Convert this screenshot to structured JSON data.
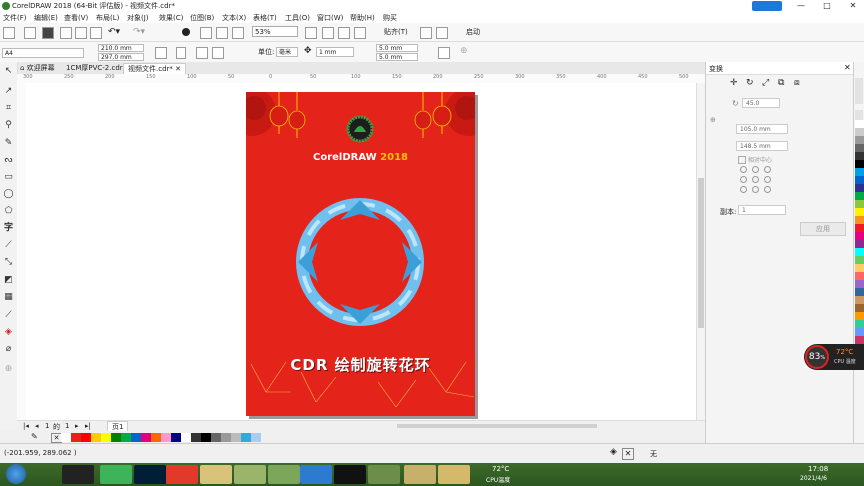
{
  "window": {
    "title": "CorelDRAW 2018 (64-Bit 评估版) - 视频文件.cdr*",
    "buttons": [
      "—",
      "□",
      "✕"
    ]
  },
  "menu": [
    "文件(F)",
    "编辑(E)",
    "查看(V)",
    "布局(L)",
    "对象(J)",
    "效果(C)",
    "位图(B)",
    "文本(X)",
    "表格(T)",
    "工具(O)",
    "窗口(W)",
    "帮助(H)",
    "购买"
  ],
  "toolbar": {
    "zoom": "53%",
    "snap_label": "贴齐(T)",
    "launch_label": "启动"
  },
  "property_bar": {
    "page_size": "A4",
    "width": "210.0 mm",
    "height": "297.0 mm",
    "units_label": "单位:",
    "units_value": "毫米",
    "nudge": "1 mm",
    "dup_x": "5.0 mm",
    "dup_y": "5.0 mm"
  },
  "tabs": [
    {
      "label": "欢迎屏幕",
      "active": false
    },
    {
      "label": "1CM厚PVC-2.cdr",
      "active": false
    },
    {
      "label": "视频文件.cdr*",
      "active": true
    }
  ],
  "ruler": {
    "h_ticks": [
      "300",
      "250",
      "200",
      "150",
      "100",
      "50",
      "0",
      "50",
      "100",
      "150",
      "200",
      "250",
      "300",
      "350",
      "400",
      "450",
      "500"
    ],
    "unit": "毫米"
  },
  "design": {
    "brand_main": "CorelDRAW",
    "brand_year": "2018",
    "title": "CDR 绘制旋转花环",
    "background_color": "#e4231b",
    "ribbon_color": "#6fc0ee"
  },
  "page_nav": {
    "current": "1",
    "of_label": "的",
    "total": "1",
    "page_tab": "页1"
  },
  "palette": [
    "#ffffff",
    "#e4231b",
    "#ff0000",
    "#ffcc00",
    "#ffff00",
    "#008000",
    "#00aa44",
    "#0066cc",
    "#e6007e",
    "#ff6600",
    "#ff99cc",
    "#000080",
    "#ffffff",
    "#333333",
    "#000000",
    "#666666",
    "#999999",
    "#bbbbbb",
    "#33aadd",
    "#aaccee"
  ],
  "dock": {
    "title": "变换",
    "angle": "45.0",
    "x": "105.0 mm",
    "y": "148.5 mm",
    "relative_label": "相对中心",
    "copies_label": "副本:",
    "copies": "1",
    "apply_label": "应用"
  },
  "right_palette": [
    "#ffffff",
    "#cccccc",
    "#999999",
    "#666666",
    "#333333",
    "#000000",
    "#00a0e9",
    "#0066cc",
    "#2e3192",
    "#00aa44",
    "#8dc63f",
    "#fff200",
    "#f7941d",
    "#ed1c24",
    "#e4007f",
    "#92278f",
    "#00ffff",
    "#66cc66",
    "#ffcc66",
    "#ff6666",
    "#9966cc",
    "#336699",
    "#cc9966",
    "#996633",
    "#ff9900",
    "#33cc99",
    "#6699ff",
    "#cc3366"
  ],
  "cpu": {
    "percent": "83",
    "percent_unit": "%",
    "temp": "72°C",
    "label": "CPU 温度"
  },
  "status": {
    "coords": "(-201.959, 289.062 )",
    "fill_label": "无"
  },
  "taskbar": {
    "cpu_temp": "72°C",
    "cpu_label": "CPU温度",
    "time": "17:08",
    "date": "2021/4/6"
  }
}
